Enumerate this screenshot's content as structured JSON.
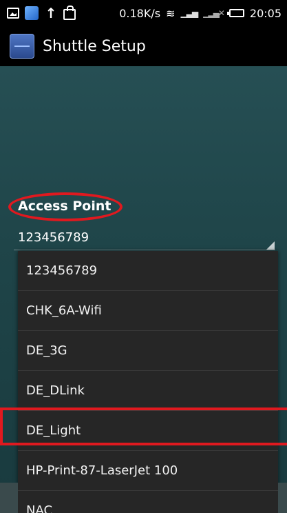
{
  "status_bar": {
    "speed": "0.18K/s",
    "time": "20:05",
    "icons": [
      "gallery-icon",
      "app-notification-icon",
      "upload-arrow-icon",
      "bag-icon",
      "wifi-icon",
      "signal-icon",
      "no-signal-icon",
      "battery-icon"
    ]
  },
  "action_bar": {
    "title": "Shuttle Setup"
  },
  "form": {
    "access_point_label": "Access Point",
    "access_point_value": "123456789"
  },
  "dropdown": {
    "items": [
      "123456789",
      "CHK_6A-Wifi",
      "DE_3G",
      "DE_DLink",
      "DE_Light",
      "HP-Print-87-LaserJet 100",
      "NAC"
    ]
  },
  "annotations": {
    "highlight_color": "#e0191f",
    "circled_label": "Access Point",
    "boxed_item": "DE_Light"
  }
}
